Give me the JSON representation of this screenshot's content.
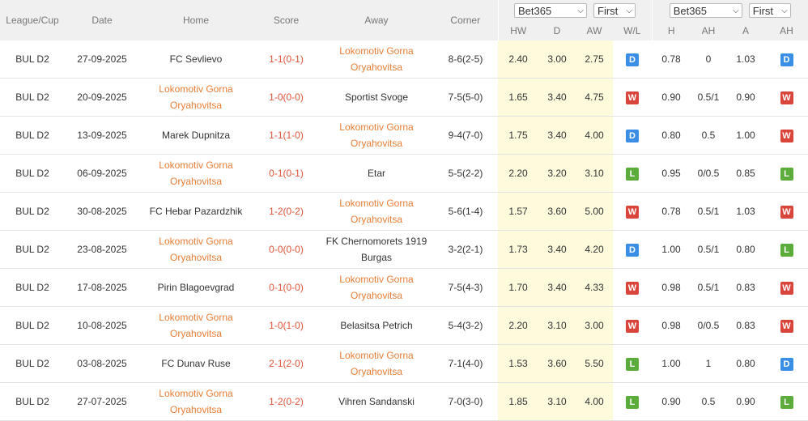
{
  "header": {
    "league": "League/Cup",
    "date": "Date",
    "home": "Home",
    "score": "Score",
    "away": "Away",
    "corner": "Corner",
    "group1": {
      "bookmaker": "Bet365",
      "period": "First"
    },
    "group2": {
      "bookmaker": "Bet365",
      "period": "First"
    },
    "sub": {
      "hw": "HW",
      "d": "D",
      "aw": "AW",
      "wl": "W/L",
      "h": "H",
      "ah": "AH",
      "a": "A",
      "ah2": "AH"
    }
  },
  "colors": {
    "orange_team": "#e67e38",
    "score": "#e0553a",
    "D": "#3b8ee6",
    "W": "#d9453b",
    "L": "#5cac3b",
    "odds_highlight": "#fdfbdc"
  },
  "rows": [
    {
      "league": "BUL D2",
      "date": "27-09-2025",
      "home": "FC Sevlievo",
      "home_hl": false,
      "score": "1-1(0-1)",
      "away_l1": "Lokomotiv Gorna",
      "away_l2": "Oryahovitsa",
      "away_hl": true,
      "corner": "8-6(2-5)",
      "hw": "2.40",
      "d": "3.00",
      "aw": "2.75",
      "wl": "D",
      "h": "0.78",
      "ah": "0",
      "a": "1.03",
      "ah_res": "D"
    },
    {
      "league": "BUL D2",
      "date": "20-09-2025",
      "home_l1": "Lokomotiv Gorna",
      "home_l2": "Oryahovitsa",
      "home_hl": true,
      "score": "1-0(0-0)",
      "away": "Sportist Svoge",
      "away_hl": false,
      "corner": "7-5(5-0)",
      "hw": "1.65",
      "d": "3.40",
      "aw": "4.75",
      "wl": "W",
      "h": "0.90",
      "ah": "0.5/1",
      "a": "0.90",
      "ah_res": "W"
    },
    {
      "league": "BUL D2",
      "date": "13-09-2025",
      "home": "Marek Dupnitza",
      "home_hl": false,
      "score": "1-1(1-0)",
      "away_l1": "Lokomotiv Gorna",
      "away_l2": "Oryahovitsa",
      "away_hl": true,
      "corner": "9-4(7-0)",
      "hw": "1.75",
      "d": "3.40",
      "aw": "4.00",
      "wl": "D",
      "h": "0.80",
      "ah": "0.5",
      "a": "1.00",
      "ah_res": "W"
    },
    {
      "league": "BUL D2",
      "date": "06-09-2025",
      "home_l1": "Lokomotiv Gorna",
      "home_l2": "Oryahovitsa",
      "home_hl": true,
      "score": "0-1(0-1)",
      "away": "Etar",
      "away_hl": false,
      "corner": "5-5(2-2)",
      "hw": "2.20",
      "d": "3.20",
      "aw": "3.10",
      "wl": "L",
      "h": "0.95",
      "ah": "0/0.5",
      "a": "0.85",
      "ah_res": "L"
    },
    {
      "league": "BUL D2",
      "date": "30-08-2025",
      "home": "FC Hebar Pazardzhik",
      "home_hl": false,
      "score": "1-2(0-2)",
      "away_l1": "Lokomotiv Gorna",
      "away_l2": "Oryahovitsa",
      "away_hl": true,
      "corner": "5-6(1-4)",
      "hw": "1.57",
      "d": "3.60",
      "aw": "5.00",
      "wl": "W",
      "h": "0.78",
      "ah": "0.5/1",
      "a": "1.03",
      "ah_res": "W"
    },
    {
      "league": "BUL D2",
      "date": "23-08-2025",
      "home_l1": "Lokomotiv Gorna",
      "home_l2": "Oryahovitsa",
      "home_hl": true,
      "score": "0-0(0-0)",
      "away_l1": "FK Chernomorets 1919",
      "away_l2": "Burgas",
      "away_hl": false,
      "corner": "3-2(2-1)",
      "hw": "1.73",
      "d": "3.40",
      "aw": "4.20",
      "wl": "D",
      "h": "1.00",
      "ah": "0.5/1",
      "a": "0.80",
      "ah_res": "L"
    },
    {
      "league": "BUL D2",
      "date": "17-08-2025",
      "home": "Pirin Blagoevgrad",
      "home_hl": false,
      "score": "0-1(0-0)",
      "away_l1": "Lokomotiv Gorna",
      "away_l2": "Oryahovitsa",
      "away_hl": true,
      "corner": "7-5(4-3)",
      "hw": "1.70",
      "d": "3.40",
      "aw": "4.33",
      "wl": "W",
      "h": "0.98",
      "ah": "0.5/1",
      "a": "0.83",
      "ah_res": "W"
    },
    {
      "league": "BUL D2",
      "date": "10-08-2025",
      "home_l1": "Lokomotiv Gorna",
      "home_l2": "Oryahovitsa",
      "home_hl": true,
      "score": "1-0(1-0)",
      "away": "Belasitsa Petrich",
      "away_hl": false,
      "corner": "5-4(3-2)",
      "hw": "2.20",
      "d": "3.10",
      "aw": "3.00",
      "wl": "W",
      "h": "0.98",
      "ah": "0/0.5",
      "a": "0.83",
      "ah_res": "W"
    },
    {
      "league": "BUL D2",
      "date": "03-08-2025",
      "home": "FC Dunav Ruse",
      "home_hl": false,
      "score": "2-1(2-0)",
      "away_l1": "Lokomotiv Gorna",
      "away_l2": "Oryahovitsa",
      "away_hl": true,
      "corner": "7-1(4-0)",
      "hw": "1.53",
      "d": "3.60",
      "aw": "5.50",
      "wl": "L",
      "h": "1.00",
      "ah": "1",
      "a": "0.80",
      "ah_res": "D"
    },
    {
      "league": "BUL D2",
      "date": "27-07-2025",
      "home_l1": "Lokomotiv Gorna",
      "home_l2": "Oryahovitsa",
      "home_hl": true,
      "score": "1-2(0-2)",
      "away": "Vihren Sandanski",
      "away_hl": false,
      "corner": "7-0(3-0)",
      "hw": "1.85",
      "d": "3.10",
      "aw": "4.00",
      "wl": "L",
      "h": "0.90",
      "ah": "0.5",
      "a": "0.90",
      "ah_res": "L"
    }
  ]
}
